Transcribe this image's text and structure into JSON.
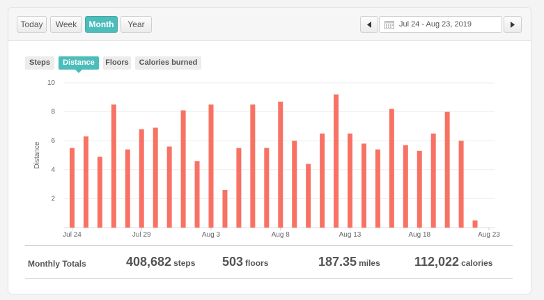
{
  "range_buttons": [
    {
      "label": "Today",
      "active": false
    },
    {
      "label": "Week",
      "active": false
    },
    {
      "label": "Month",
      "active": true
    },
    {
      "label": "Year",
      "active": false
    }
  ],
  "date_range": "Jul 24 - Aug 23, 2019",
  "metric_tabs": [
    {
      "label": "Steps",
      "active": false
    },
    {
      "label": "Distance",
      "active": true
    },
    {
      "label": "Floors",
      "active": false
    },
    {
      "label": "Calories burned",
      "active": false
    }
  ],
  "chart_data": {
    "type": "bar",
    "ylabel": "Distance",
    "ylim": [
      0,
      10
    ],
    "yticks": [
      "2",
      "4",
      "6",
      "8",
      "10"
    ],
    "grid": true,
    "bar_color": "#f87264",
    "x_tick_labels": [
      {
        "label": "Jul 24",
        "index": 0
      },
      {
        "label": "Jul 29",
        "index": 5
      },
      {
        "label": "Aug 3",
        "index": 10
      },
      {
        "label": "Aug 8",
        "index": 15
      },
      {
        "label": "Aug 13",
        "index": 20
      },
      {
        "label": "Aug 18",
        "index": 25
      },
      {
        "label": "Aug 23",
        "index": 30
      }
    ],
    "categories": [
      "Jul 24",
      "Jul 25",
      "Jul 26",
      "Jul 27",
      "Jul 28",
      "Jul 29",
      "Jul 30",
      "Jul 31",
      "Aug 1",
      "Aug 2",
      "Aug 3",
      "Aug 4",
      "Aug 5",
      "Aug 6",
      "Aug 7",
      "Aug 8",
      "Aug 9",
      "Aug 10",
      "Aug 11",
      "Aug 12",
      "Aug 13",
      "Aug 14",
      "Aug 15",
      "Aug 16",
      "Aug 17",
      "Aug 18",
      "Aug 19",
      "Aug 20",
      "Aug 21",
      "Aug 22",
      "Aug 23"
    ],
    "values": [
      5.5,
      6.3,
      4.9,
      8.5,
      5.4,
      6.8,
      6.9,
      5.6,
      8.1,
      4.6,
      8.5,
      2.6,
      5.5,
      8.5,
      5.5,
      8.7,
      6.0,
      4.4,
      6.5,
      9.2,
      6.5,
      5.8,
      5.4,
      8.2,
      5.7,
      5.3,
      6.5,
      8.0,
      6.0,
      0.5,
      0
    ]
  },
  "totals": {
    "label": "Monthly Totals",
    "steps": {
      "value": "408,682",
      "unit": "steps"
    },
    "floors": {
      "value": "503",
      "unit": "floors"
    },
    "miles": {
      "value": "187.35",
      "unit": "miles"
    },
    "calories": {
      "value": "112,022",
      "unit": "calories"
    }
  }
}
